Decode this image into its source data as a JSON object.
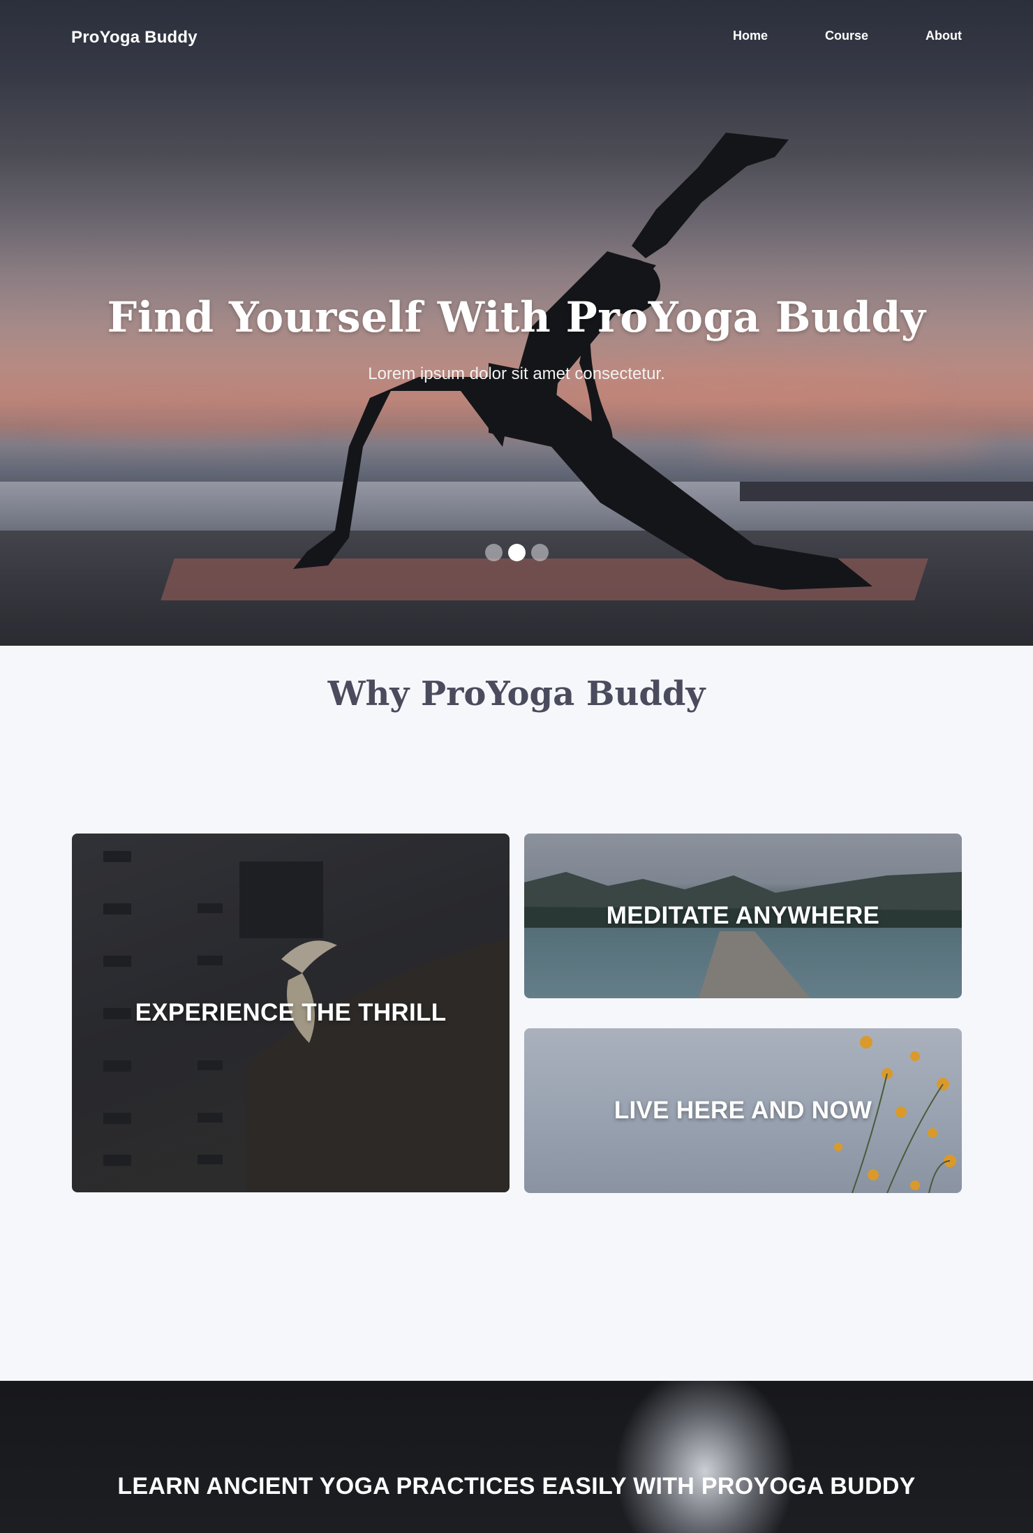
{
  "nav": {
    "brand": "ProYoga Buddy",
    "links": [
      "Home",
      "Course",
      "About"
    ]
  },
  "hero": {
    "title": "Find Yourself With ProYoga Buddy",
    "subtitle": "Lorem ipsum dolor sit amet consectetur.",
    "slides": 3,
    "active_slide": 2
  },
  "why": {
    "title": "Why ProYoga Buddy",
    "cards": [
      {
        "label": "EXPERIENCE THE THRILL"
      },
      {
        "label": "MEDITATE ANYWHERE"
      },
      {
        "label": "LIVE HERE AND NOW"
      }
    ]
  },
  "banner": {
    "text": "LEARN ANCIENT YOGA PRACTICES EASILY WITH PROYOGA BUDDY"
  },
  "colors": {
    "page_bg": "#f6f7fb",
    "heading": "#4a4b5c",
    "white": "#ffffff"
  }
}
